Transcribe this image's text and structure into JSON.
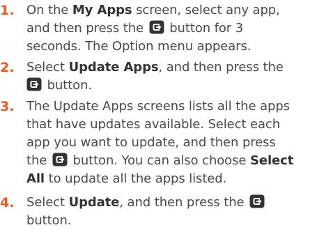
{
  "colors": {
    "number": "#e85a1e",
    "text": "#4a4a4a",
    "icon": "#333333"
  },
  "icon": "enter-button-icon",
  "steps": [
    {
      "number": "1.",
      "lines": [
        [
          "On the ",
          "My Apps",
          " screen, select any app,"
        ],
        [
          "and then press the ",
          "",
          " button for 3"
        ],
        [
          "seconds. The Option menu appears."
        ]
      ]
    },
    {
      "number": "2.",
      "lines": [
        [
          "Select ",
          "Update Apps",
          ", and then press the"
        ],
        [
          "",
          " button."
        ]
      ]
    },
    {
      "number": "3.",
      "lines": [
        [
          "The Update Apps screens lists all the apps"
        ],
        [
          "that have updates available. Select each"
        ],
        [
          "app you want to update, and then press"
        ],
        [
          "the ",
          "",
          " button. You can also choose ",
          "Select"
        ],
        [
          "All",
          " to update all the apps listed."
        ]
      ]
    },
    {
      "number": "4.",
      "lines": [
        [
          "Select ",
          "Update",
          ", and then press the ",
          ""
        ],
        [
          "button."
        ]
      ]
    }
  ]
}
